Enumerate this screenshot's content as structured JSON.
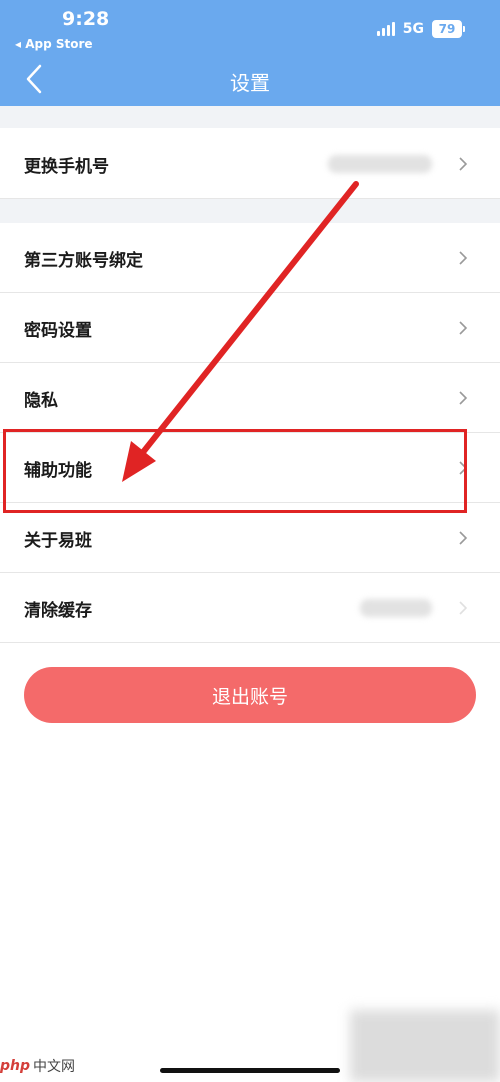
{
  "status_bar": {
    "time": "9:28",
    "back_app": "◂ App Store",
    "network": "5G",
    "battery": "79"
  },
  "nav": {
    "title": "设置"
  },
  "settings": {
    "change_phone": "更换手机号",
    "third_party": "第三方账号绑定",
    "password": "密码设置",
    "privacy": "隐私",
    "accessibility": "辅助功能",
    "about": "关于易班",
    "clear_cache": "清除缓存"
  },
  "logout_label": "退出账号",
  "watermark": {
    "logo": "php",
    "text": "中文网"
  },
  "colors": {
    "header": "#6aa9ee",
    "logout": "#f46a6a",
    "highlight": "#e02424",
    "section_bg": "#f1f3f6"
  }
}
